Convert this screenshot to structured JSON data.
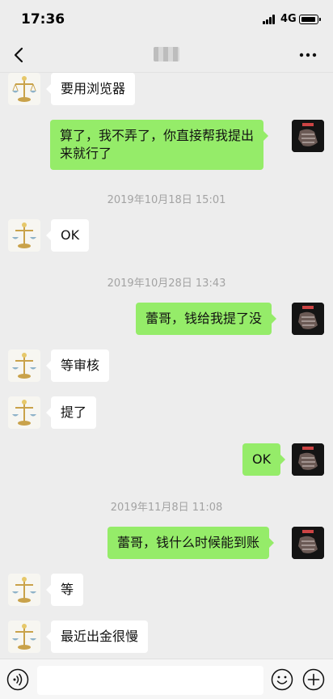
{
  "status_bar": {
    "time": "17:36",
    "network": "4G"
  },
  "header": {
    "title": ""
  },
  "messages": [
    {
      "side": "left",
      "lines": [
        "要用浏览器"
      ]
    },
    {
      "side": "right",
      "lines": [
        "算了，我不弄了，你直接帮我提出",
        "来就行了"
      ]
    },
    {
      "timestamp": "2019年10月18日 15:01"
    },
    {
      "side": "left",
      "lines": [
        "OK"
      ]
    },
    {
      "timestamp": "2019年10月28日 13:43"
    },
    {
      "side": "right",
      "lines": [
        "蕾哥，钱给我提了没"
      ]
    },
    {
      "side": "left",
      "lines": [
        "等审核"
      ]
    },
    {
      "side": "left",
      "lines": [
        "提了"
      ]
    },
    {
      "side": "right",
      "lines": [
        "OK"
      ]
    },
    {
      "timestamp": "2019年11月8日 11:08"
    },
    {
      "side": "right",
      "lines": [
        "蕾哥，钱什么时候能到账"
      ]
    },
    {
      "side": "left",
      "lines": [
        "等"
      ]
    },
    {
      "side": "left",
      "lines": [
        "最近出金很慢"
      ]
    }
  ],
  "icons": {
    "back": "chevron-left-icon",
    "more": "more-dots-icon",
    "voice": "voice-icon",
    "emoji": "emoji-icon",
    "plus": "plus-icon"
  },
  "colors": {
    "background": "#ededed",
    "sent_bubble": "#95ec69",
    "received_bubble": "#ffffff",
    "timestamp": "#a3a3a3"
  }
}
